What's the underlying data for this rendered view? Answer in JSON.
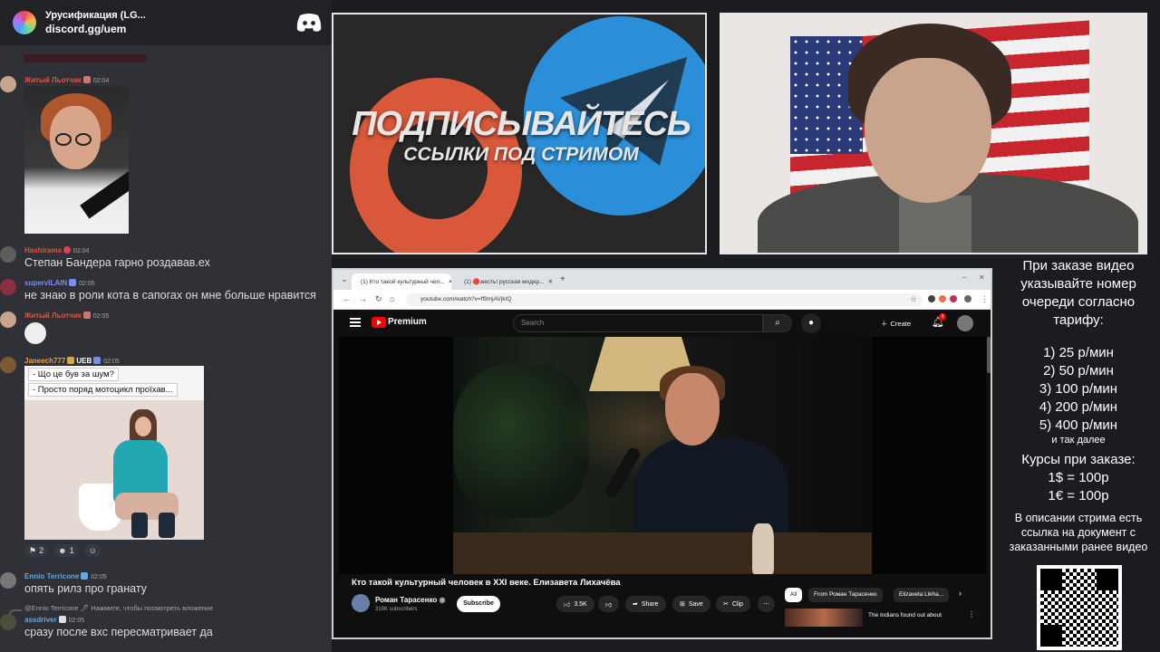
{
  "discord": {
    "server_title": "Урусификация (LG...",
    "server_link": "discord.gg/uem",
    "messages": [
      {
        "user": "Житый Льотчик",
        "time": "02:04",
        "color": "#e0553f",
        "text": ""
      },
      {
        "user": "Hashirama",
        "time": "02:04",
        "color": "#e0553f",
        "text": "Степан Бандера гарно роздавав.ех"
      },
      {
        "user": "supervILAIN",
        "time": "02:05",
        "color": "#7a8cf0",
        "text": "не знаю в роли кота в сапогах он мне больше нравится"
      },
      {
        "user": "Житый Льотчик",
        "time": "02:05",
        "color": "#e0553f",
        "text": ""
      },
      {
        "user": "Janeech777",
        "time": "02:05",
        "color": "#e9a23b",
        "badge": "UEB",
        "text": ""
      },
      {
        "user": "Ennio Terricone",
        "time": "02:05",
        "color": "#5fa8e8",
        "text": "опять рилз про гранату"
      },
      {
        "user": "assdriver",
        "time": "02:05",
        "color": "#5fa8e8",
        "text": "сразу после вхс пересматривает да"
      }
    ],
    "meme_lines": [
      "- Що це був за шум?",
      "- Просто поряд мотоцикл проїхав..."
    ],
    "reactions": [
      "2",
      "1"
    ],
    "reply_text": "@Ennio Terricone 🖊 Нажмите, чтобы посмотреть вложение"
  },
  "promo": {
    "line1": "ПОДПИСЫВАЙТЕСЬ",
    "line2": "ССЫЛКИ ПОД СТРИМОМ"
  },
  "browser": {
    "tab1": "(1) Кто такой культурный чел...",
    "tab2": "(1) 🔴жесть! русская модер...",
    "url": "youtube.com/watch?v=ff9mjAVjkIQ",
    "brand": "Premium",
    "search_placeholder": "Search",
    "create_label": "Create",
    "bell_count": "9",
    "video_title": "Кто такой культурный человек в XXI веке. Елизавета Лихачёва",
    "channel_name": "Роман Тарасенко",
    "channel_subs": "318K subscribers",
    "subscribe_label": "Subscribe",
    "likes": "3.5K",
    "share_label": "Share",
    "save_label": "Save",
    "clip_label": "Clip",
    "chips": [
      "All",
      "From Роман Тарасенко",
      "Elizaveta Likha..."
    ],
    "rec_title": "The Indians found out about"
  },
  "info": {
    "heading": "При заказе видео указывайте номер очереди согласно тарифу:",
    "rates": [
      "1) 25 р/мин",
      "2) 50 р/мин",
      "3) 100 р/мин",
      "4) 200 р/мин",
      "5) 400 р/мин"
    ],
    "rates_note": "и так далее",
    "courses_heading": "Курсы при заказе:",
    "courses": [
      "1$ = 100р",
      "1€ = 100р"
    ],
    "description": "В описании стрима есть ссылка на документ с заказанными ранее видео"
  }
}
